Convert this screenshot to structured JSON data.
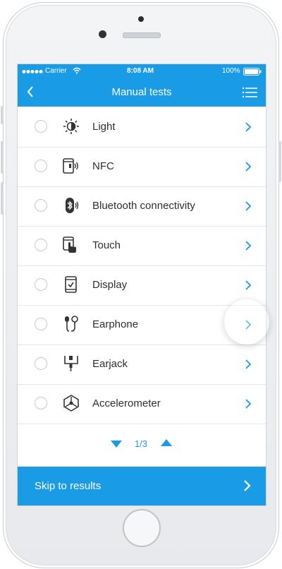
{
  "status": {
    "carrier": "Carrier",
    "time": "8:08 AM",
    "battery": "100%"
  },
  "nav": {
    "title": "Manual tests",
    "back_icon": "chevron-left-icon",
    "menu_icon": "list-icon"
  },
  "tests": [
    {
      "label": "Light",
      "icon": "brightness-icon"
    },
    {
      "label": "NFC",
      "icon": "nfc-icon"
    },
    {
      "label": "Bluetooth connectivity",
      "icon": "bluetooth-icon"
    },
    {
      "label": "Touch",
      "icon": "touch-icon"
    },
    {
      "label": "Display",
      "icon": "display-icon"
    },
    {
      "label": "Earphone",
      "icon": "earphone-icon"
    },
    {
      "label": "Earjack",
      "icon": "earjack-icon"
    },
    {
      "label": "Accelerometer",
      "icon": "accelerometer-icon"
    }
  ],
  "pager": {
    "text": "1/3"
  },
  "footer": {
    "skip_label": "Skip to results"
  },
  "colors": {
    "accent": "#1a9be6",
    "text": "#2e2e2e",
    "divider": "#e4e6e9"
  }
}
